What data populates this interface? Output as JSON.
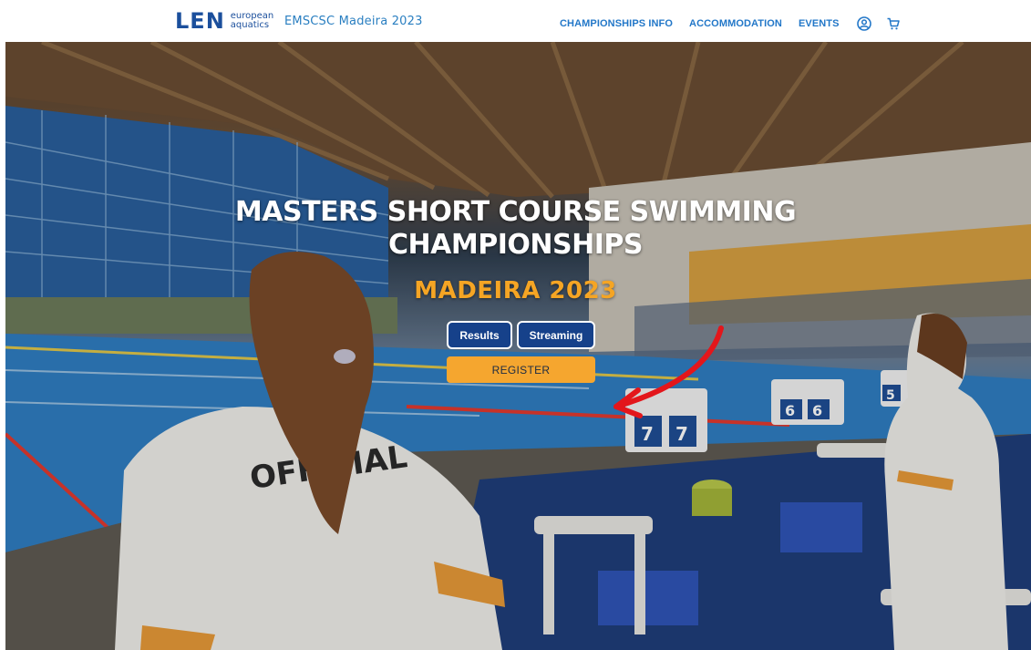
{
  "header": {
    "logo_mark": "LEN",
    "logo_line1": "european",
    "logo_line2": "aquatics",
    "site_name": "EMSCSC Madeira 2023",
    "nav": [
      {
        "label": "CHAMPIONSHIPS INFO"
      },
      {
        "label": "ACCOMMODATION"
      },
      {
        "label": "EVENTS"
      }
    ],
    "icons": [
      "user-circle-icon",
      "cart-icon"
    ]
  },
  "hero": {
    "title_line1": "MASTERS SHORT COURSE SWIMMING",
    "title_line2": "CHAMPIONSHIPS",
    "subtitle": "MADEIRA 2023",
    "buttons": {
      "results": "Results",
      "streaming": "Streaming",
      "register": "REGISTER"
    },
    "photo_text": {
      "official": "OFFICIAL",
      "lane7": "7",
      "lane6": "6",
      "lane5": "5"
    }
  },
  "colors": {
    "brand_blue": "#1b4f9c",
    "nav_blue": "#2277c8",
    "accent_orange": "#f5a524",
    "button_blue": "#16418a",
    "arrow_red": "#e3161b"
  }
}
